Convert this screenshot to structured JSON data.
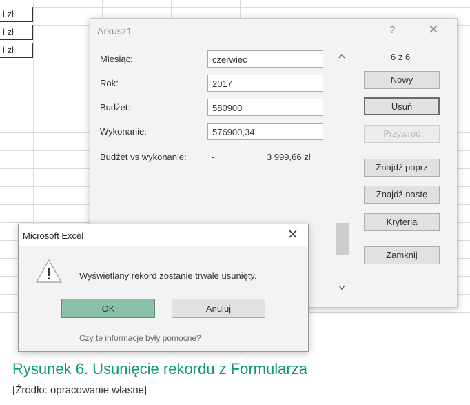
{
  "sheet": {
    "cells": [
      "i zł",
      "i zł",
      "i zł"
    ]
  },
  "form": {
    "title": "Arkusz1",
    "help": "?",
    "close": "✕",
    "fields": [
      {
        "label": "Miesiąc:",
        "value": "czerwiec"
      },
      {
        "label": "Rok:",
        "value": "2017"
      },
      {
        "label": "Budżet:",
        "value": "580900"
      },
      {
        "label": "Wykonanie:",
        "value": "576900,34"
      }
    ],
    "calculated": {
      "label": "Budżet vs wykonanie:",
      "dash": "-",
      "value": "3 999,66 zł"
    },
    "counter": "6 z 6",
    "buttons": {
      "new": "Nowy",
      "delete": "Usuń",
      "restore": "Przywróć",
      "find_prev": "Znajdź poprz",
      "find_next": "Znajdź nastę",
      "criteria": "Kryteria",
      "close": "Zamknij"
    }
  },
  "message_box": {
    "title": "Microsoft Excel",
    "close": "✕",
    "text": "Wyświetlany rekord zostanie trwale usunięty.",
    "ok": "OK",
    "cancel": "Anuluj",
    "help_link": "Czy te informacje były pomocne?"
  },
  "caption": {
    "title": "Rysunek 6. Usunięcie rekordu z Formularza",
    "source": "[Źródło: opracowanie własne]"
  },
  "colors": {
    "accent": "#0d9a6e",
    "ok_button": "#8bc2a7"
  }
}
